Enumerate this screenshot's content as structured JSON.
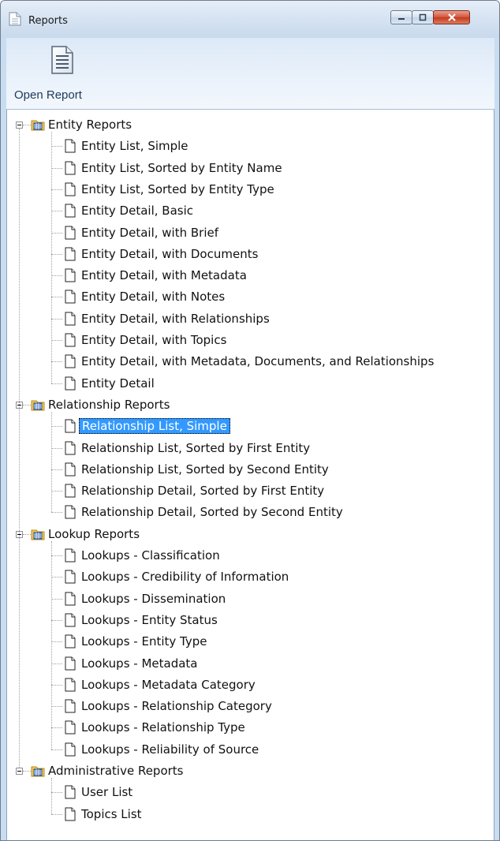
{
  "window": {
    "title": "Reports",
    "controls": {
      "minimize": "minimize",
      "maximize": "maximize",
      "close": "close"
    }
  },
  "ribbon": {
    "open_report_label": "Open Report"
  },
  "selected": "Relationship List, Simple",
  "tree": [
    {
      "label": "Entity Reports",
      "expanded": true,
      "children": [
        "Entity List, Simple",
        "Entity List, Sorted by Entity Name",
        "Entity List, Sorted by Entity Type",
        "Entity Detail, Basic",
        "Entity Detail, with Brief",
        "Entity Detail, with Documents",
        "Entity Detail, with Metadata",
        "Entity Detail, with Notes",
        "Entity Detail, with Relationships",
        "Entity Detail, with Topics",
        "Entity Detail, with Metadata, Documents, and Relationships",
        "Entity Detail"
      ]
    },
    {
      "label": "Relationship Reports",
      "expanded": true,
      "children": [
        "Relationship List, Simple",
        "Relationship List, Sorted by First Entity",
        "Relationship List, Sorted by Second Entity",
        "Relationship Detail, Sorted by First Entity",
        "Relationship Detail, Sorted by Second Entity"
      ]
    },
    {
      "label": "Lookup Reports",
      "expanded": true,
      "children": [
        "Lookups - Classification",
        "Lookups - Credibility of Information",
        "Lookups - Dissemination",
        "Lookups - Entity Status",
        "Lookups - Entity Type",
        "Lookups - Metadata",
        "Lookups - Metadata Category",
        "Lookups - Relationship Category",
        "Lookups - Relationship Type",
        "Lookups - Reliability of Source"
      ]
    },
    {
      "label": "Administrative Reports",
      "expanded": true,
      "children": [
        "User List",
        "Topics List"
      ]
    }
  ]
}
